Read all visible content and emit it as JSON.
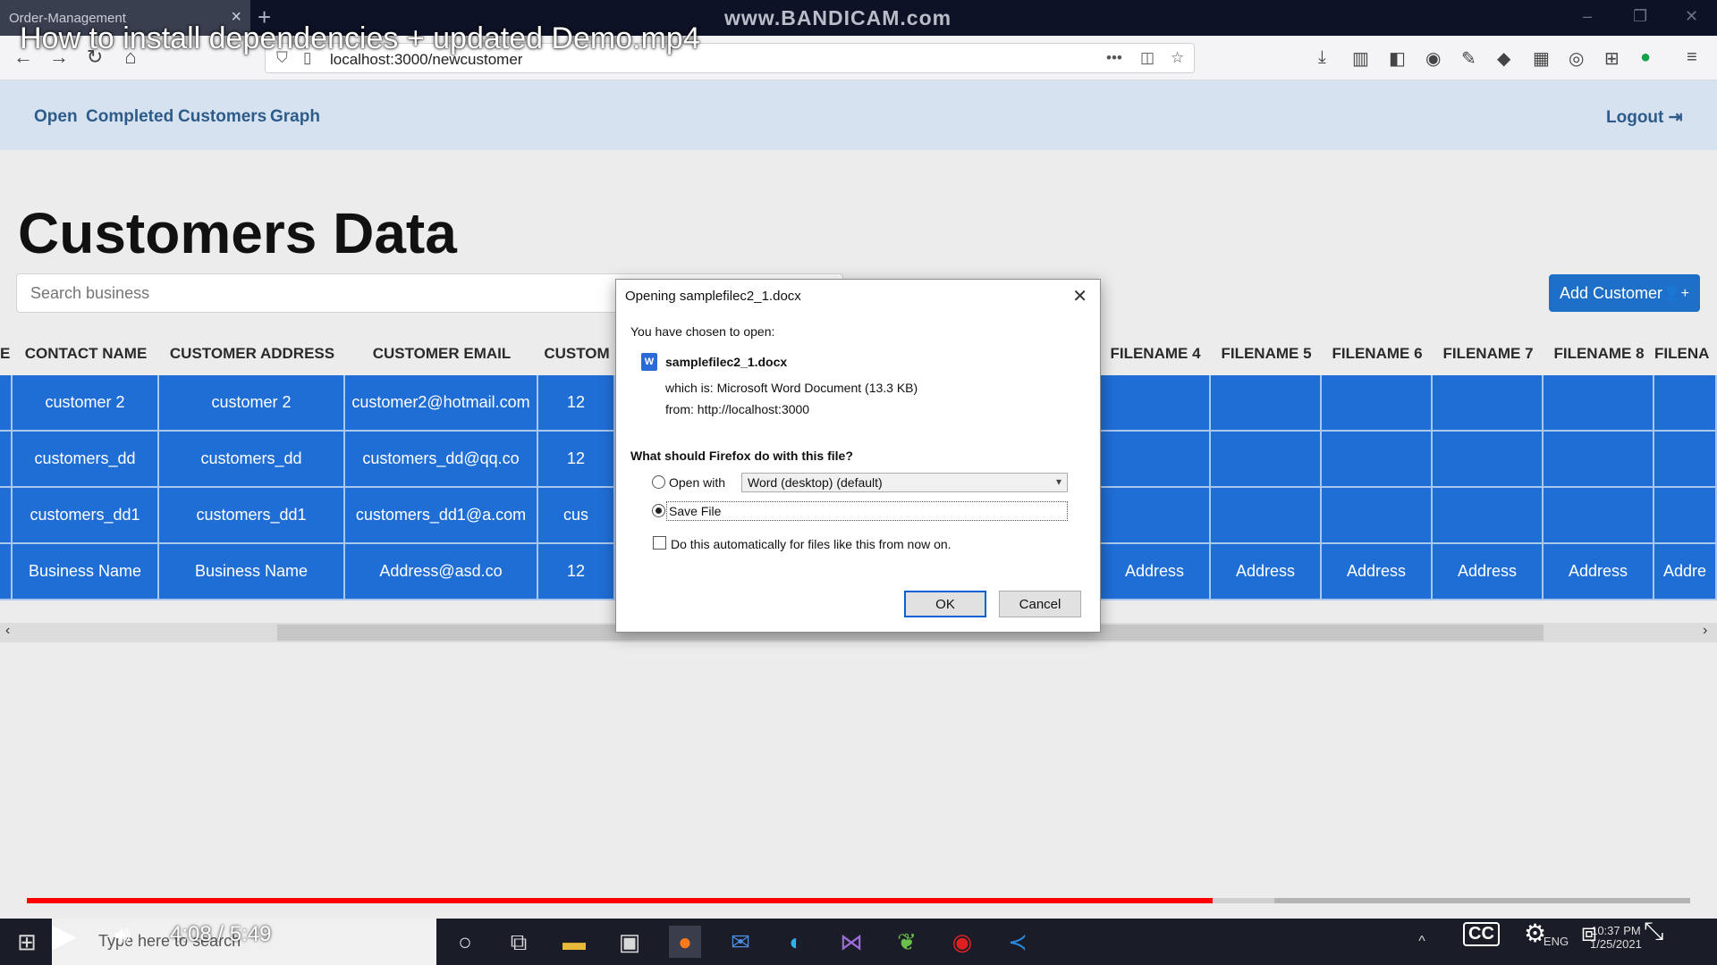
{
  "browser": {
    "tab_title": "Order-Management",
    "watermark": "www.BANDICAM.com",
    "url": "localhost:3000/newcustomer"
  },
  "video": {
    "title": "How to install dependencies + updated Demo.mp4",
    "current_time": "4:08",
    "separator": "/",
    "duration": "5:49",
    "progress": 0.713,
    "buffered": 0.75,
    "progress_color": "#ff0000"
  },
  "nav": {
    "links": [
      "Open",
      "Completed",
      "Customers",
      "Graph"
    ],
    "logout": "Logout"
  },
  "page": {
    "title": "Customers Data",
    "search_placeholder": "Search business",
    "add_button": "Add Customer",
    "accent": "#1e6fc7"
  },
  "table": {
    "columns": [
      "E",
      "CONTACT NAME",
      "CUSTOMER ADDRESS",
      "CUSTOMER EMAIL",
      "CUSTOM",
      "FILENAME 4",
      "FILENAME 5",
      "FILENAME 6",
      "FILENAME 7",
      "FILENAME 8",
      "FILENA"
    ],
    "rows": [
      [
        "customer 2",
        "customer 2",
        "customer2@hotmail.com",
        "12",
        "",
        "",
        "",
        "",
        "",
        ""
      ],
      [
        "customers_dd",
        "customers_dd",
        "customers_dd@qq.co",
        "12",
        "",
        "",
        "",
        "",
        "",
        ""
      ],
      [
        "customers_dd1",
        "customers_dd1",
        "customers_dd1@a.com",
        "cus",
        "",
        "",
        "",
        "",
        "",
        ""
      ],
      [
        "Business Name",
        "Business Name",
        "Address@asd.co",
        "12",
        "Address",
        "Address",
        "Address",
        "Address",
        "Address",
        "Addre"
      ]
    ]
  },
  "dialog": {
    "title": "Opening samplefilec2_1.docx",
    "chosen": "You have chosen to open:",
    "filename": "samplefilec2_1.docx",
    "which_is": "which is: Microsoft Word Document (13.3 KB)",
    "from": "from: http://localhost:3000",
    "question": "What should Firefox do with this file?",
    "open_with_label": "Open with",
    "open_with_value": "Word (desktop) (default)",
    "save_file_label": "Save File",
    "auto_label": "Do this automatically for files like this from now on.",
    "ok": "OK",
    "cancel": "Cancel"
  },
  "taskbar": {
    "search_placeholder": "Type here to search",
    "lang": "ENG",
    "time": "10:37 PM",
    "date": "1/25/2021"
  }
}
